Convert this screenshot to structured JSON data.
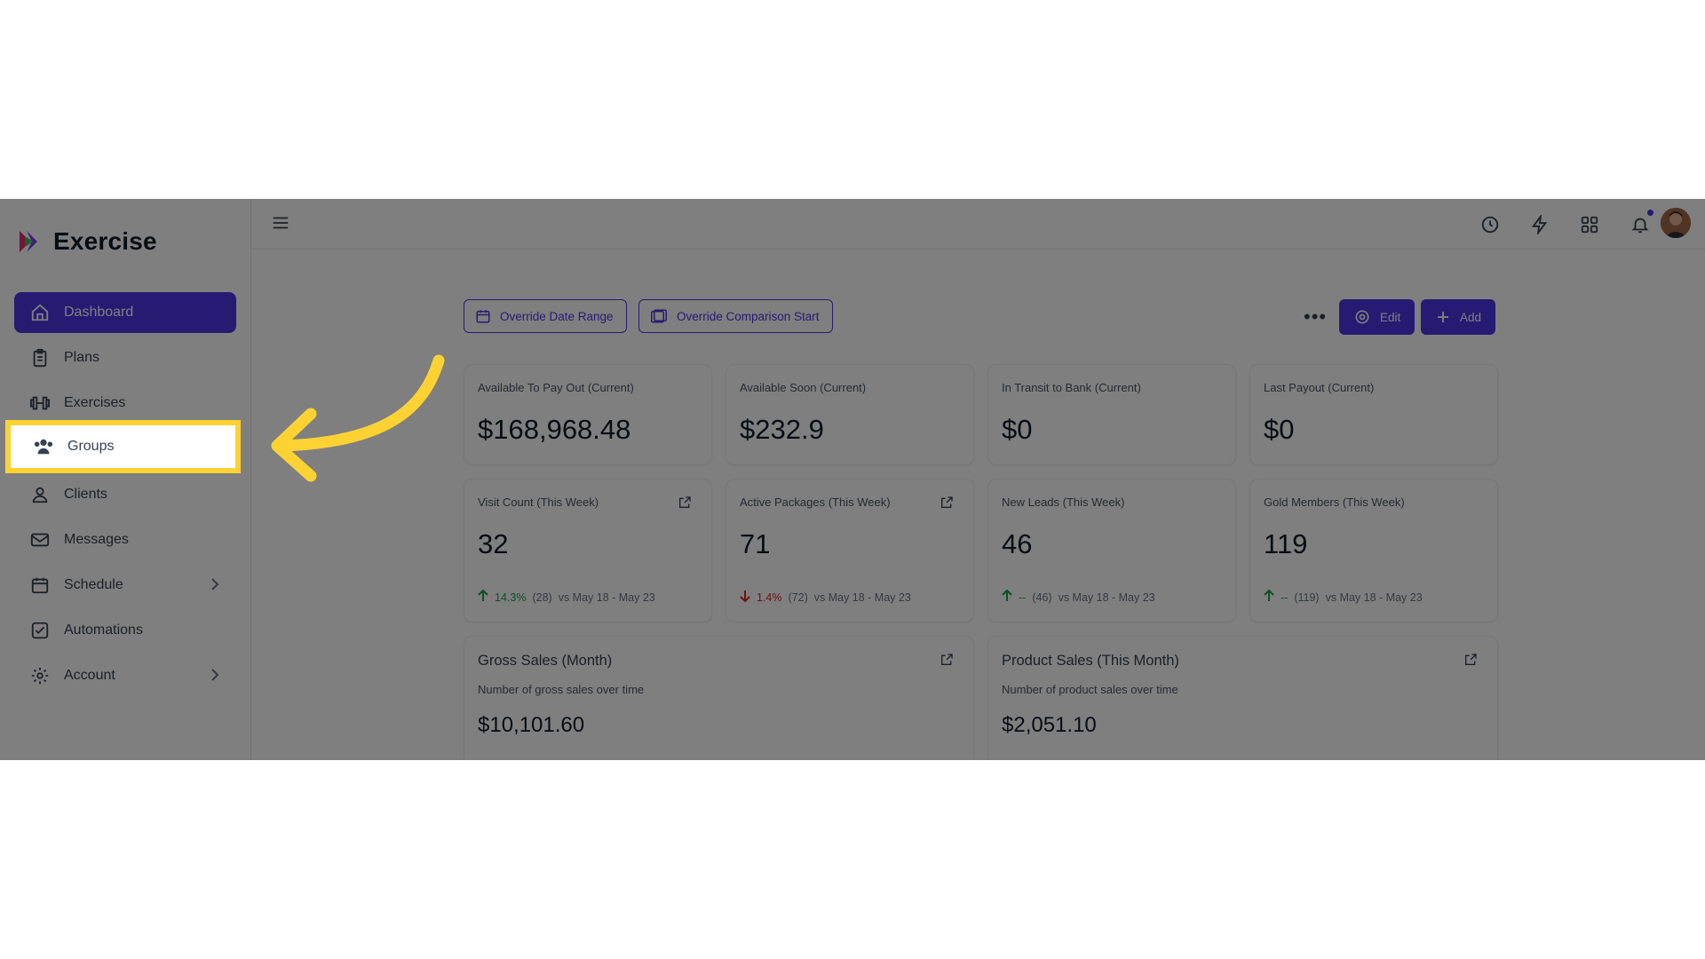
{
  "app": {
    "name": "Exercise"
  },
  "sidebar": {
    "items": [
      {
        "label": "Dashboard",
        "icon": "home-icon",
        "active": true
      },
      {
        "label": "Plans",
        "icon": "clipboard-icon"
      },
      {
        "label": "Exercises",
        "icon": "dumbbell-icon"
      },
      {
        "label": "Groups",
        "icon": "users-icon",
        "highlighted": true
      },
      {
        "label": "Clients",
        "icon": "user-icon"
      },
      {
        "label": "Messages",
        "icon": "mail-icon"
      },
      {
        "label": "Schedule",
        "icon": "calendar-icon",
        "has_submenu": true
      },
      {
        "label": "Automations",
        "icon": "checkbox-icon"
      },
      {
        "label": "Account",
        "icon": "gear-icon",
        "has_submenu": true
      }
    ]
  },
  "topbar": {
    "icons": [
      "menu-icon",
      "clock-icon",
      "bolt-icon",
      "grid-icon",
      "bell-icon",
      "avatar"
    ]
  },
  "toolbar": {
    "override_date_range": "Override Date Range",
    "override_comparison_start": "Override Comparison Start",
    "more": "•••",
    "edit": "Edit",
    "add": "Add"
  },
  "stats_row1": [
    {
      "title": "Available To Pay Out (Current)",
      "value": "$168,968.48"
    },
    {
      "title": "Available Soon (Current)",
      "value": "$232.9"
    },
    {
      "title": "In Transit to Bank (Current)",
      "value": "$0"
    },
    {
      "title": "Last Payout (Current)",
      "value": "$0"
    }
  ],
  "stats_row2": [
    {
      "title": "Visit Count (This Week)",
      "value": "32",
      "direction": "up",
      "change": "14.3%",
      "prev": "(28)",
      "compare": "vs May 18 - May 23"
    },
    {
      "title": "Active Packages (This Week)",
      "value": "71",
      "direction": "down",
      "change": "1.4%",
      "prev": "(72)",
      "compare": "vs May 18 - May 23"
    },
    {
      "title": "New Leads (This Week)",
      "value": "46",
      "direction": "up",
      "change": "--",
      "prev": "(46)",
      "compare": "vs May 18 - May 23"
    },
    {
      "title": "Gold Members (This Week)",
      "value": "119",
      "direction": "up",
      "change": "--",
      "prev": "(119)",
      "compare": "vs May 18 - May 23"
    }
  ],
  "charts": [
    {
      "title": "Gross Sales (Month)",
      "subtitle": "Number of gross sales over time",
      "value": "$10,101.60"
    },
    {
      "title": "Product Sales (This Month)",
      "subtitle": "Number of product sales over time",
      "value": "$2,051.10"
    }
  ],
  "colors": {
    "accent": "#4f35e6",
    "highlight": "#ffd233",
    "up": "#16a34a",
    "down": "#dc2626"
  }
}
